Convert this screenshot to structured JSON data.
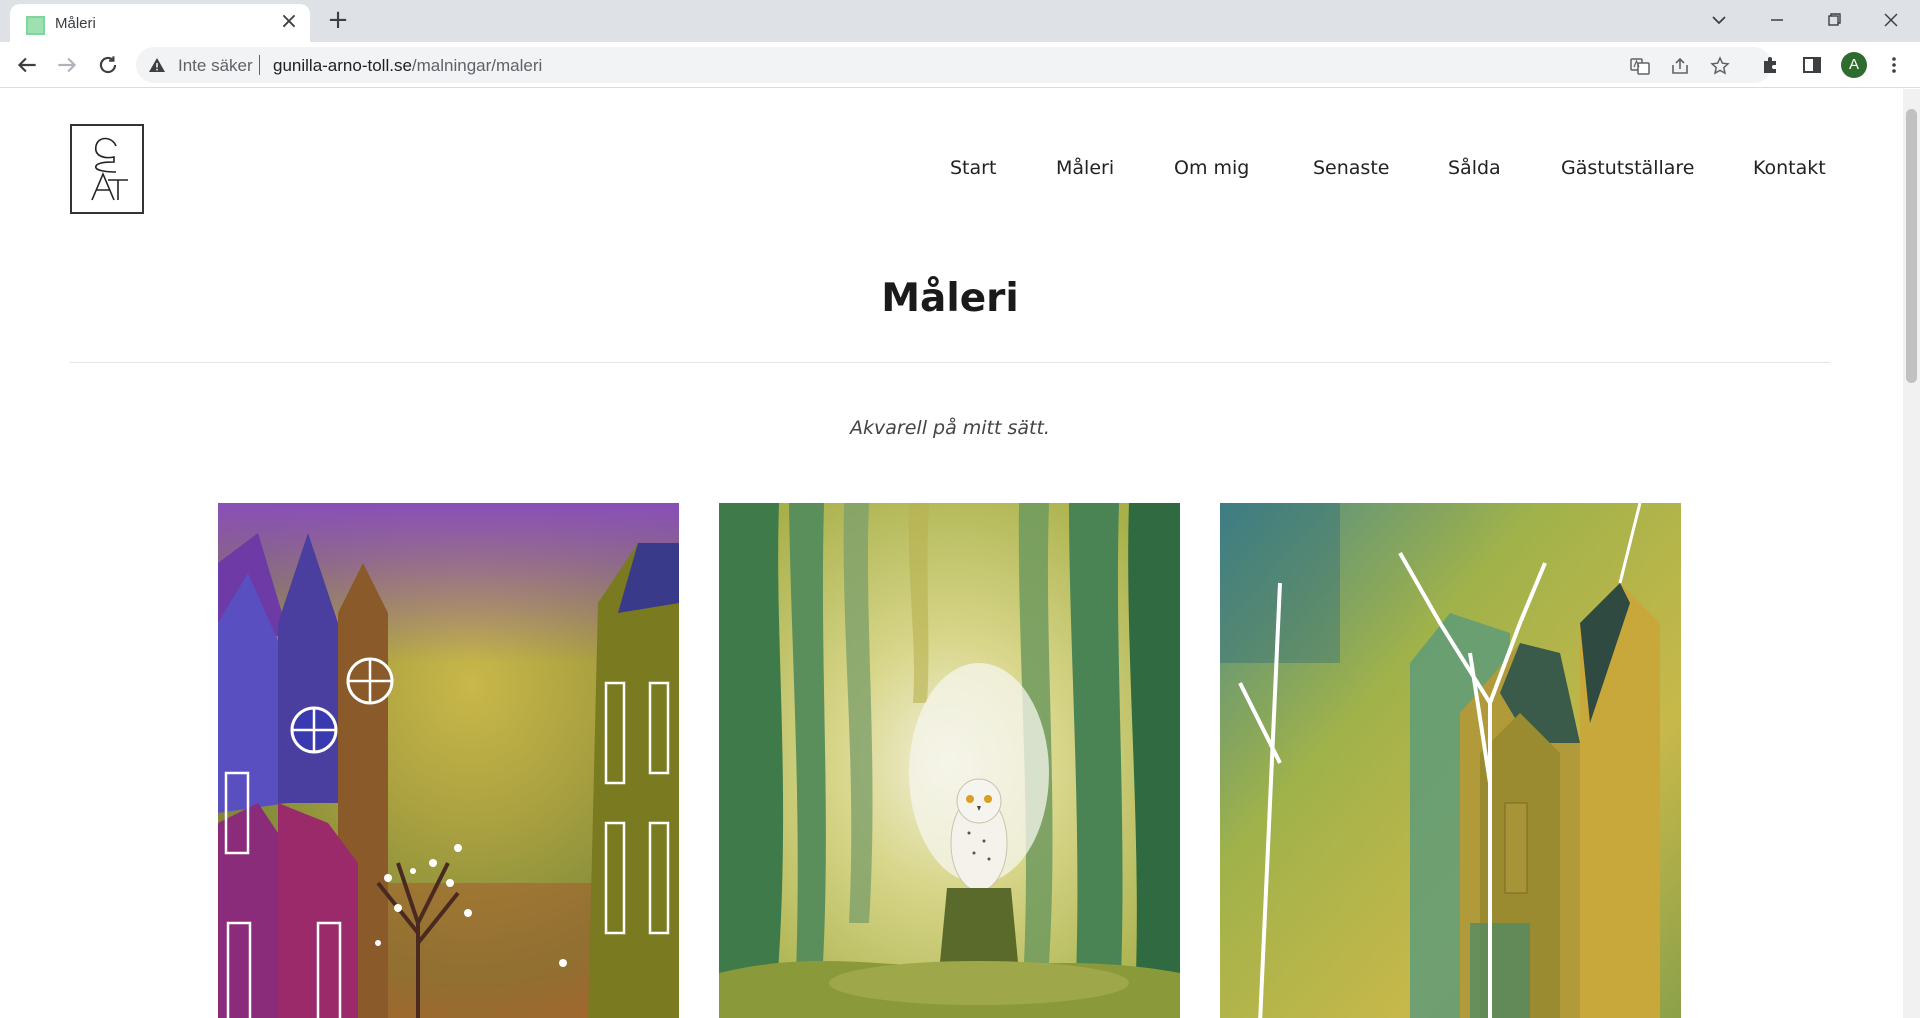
{
  "browser": {
    "tab_title": "Måleri",
    "security_label": "Inte säker",
    "url_host": "gunilla-arno-toll.se",
    "url_path": "/malningar/maleri",
    "profile_initial": "A"
  },
  "site": {
    "logo_letters": "GAT",
    "nav": [
      {
        "label": "Start"
      },
      {
        "label": "Måleri"
      },
      {
        "label": "Om mig"
      },
      {
        "label": "Senaste"
      },
      {
        "label": "Sålda"
      },
      {
        "label": "Gästutställare"
      },
      {
        "label": "Kontakt"
      }
    ],
    "page_title": "Måleri",
    "tagline": "Akvarell på mitt sätt."
  },
  "gallery": [
    {
      "subject": "houses-with-tree-painting"
    },
    {
      "subject": "owl-in-forest-painting"
    },
    {
      "subject": "houses-with-birches-painting"
    }
  ],
  "colors": {
    "tabstrip": "#dee1e6",
    "omnibox": "#f1f3f4",
    "avatar": "#2e6b2e",
    "text": "#222222"
  }
}
